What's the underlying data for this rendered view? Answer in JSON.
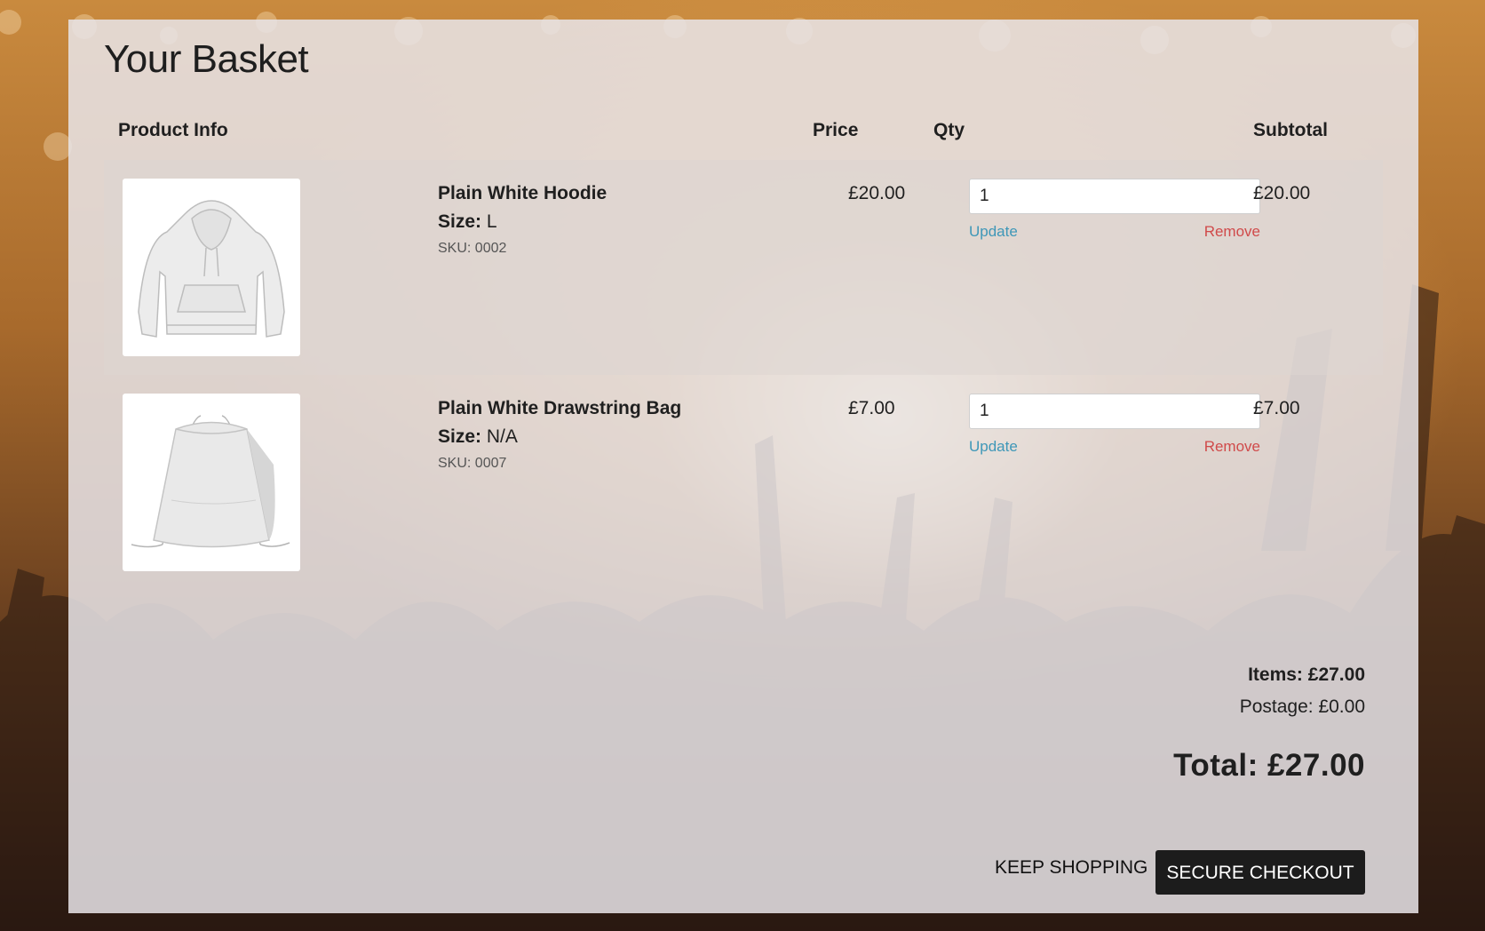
{
  "page": {
    "title": "Your Basket"
  },
  "table": {
    "headers": {
      "product_info": "Product Info",
      "price": "Price",
      "qty": "Qty",
      "subtotal": "Subtotal"
    },
    "size_label": "Size:",
    "update_label": "Update",
    "remove_label": "Remove",
    "rows": [
      {
        "name": "Plain White Hoodie",
        "size": "L",
        "sku": "SKU: 0002",
        "price": "£20.00",
        "qty": "1",
        "subtotal": "£20.00",
        "image_icon": "hoodie-image"
      },
      {
        "name": "Plain White Drawstring Bag",
        "size": "N/A",
        "sku": "SKU: 0007",
        "price": "£7.00",
        "qty": "1",
        "subtotal": "£7.00",
        "image_icon": "drawstring-bag-image"
      }
    ]
  },
  "summary": {
    "items": "Items: £27.00",
    "postage": "Postage: £0.00",
    "total": "Total: £27.00"
  },
  "actions": {
    "keep_shopping": "KEEP SHOPPING",
    "secure_checkout": "SECURE CHECKOUT"
  },
  "colors": {
    "update_link": "#3e97b8",
    "remove_link": "#d04a4a",
    "checkout_button": "#1c1c1c"
  }
}
